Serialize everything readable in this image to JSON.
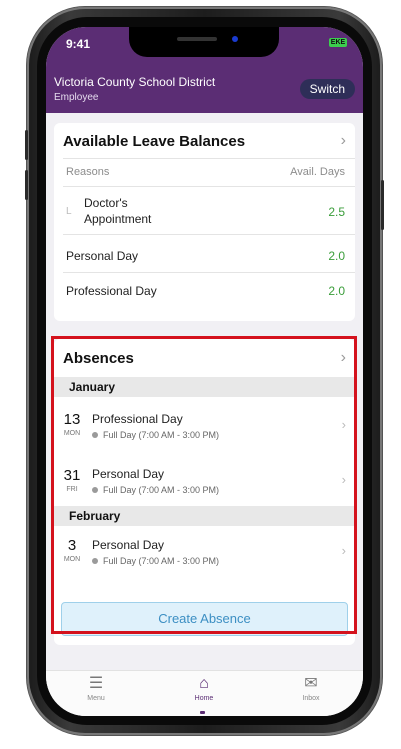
{
  "status": {
    "time": "9:41",
    "battery": "EKE"
  },
  "header": {
    "org": "Victoria County School District",
    "role": "Employee",
    "switch_label": "Switch"
  },
  "leave": {
    "title": "Available Leave Balances",
    "col_reasons": "Reasons",
    "col_days": "Avail. Days",
    "rows": [
      {
        "reason_line1": "Doctor's",
        "reason_line2": "Appointment",
        "days": "2.5"
      },
      {
        "reason": "Personal Day",
        "days": "2.0"
      },
      {
        "reason": "Professional Day",
        "days": "2.0"
      }
    ]
  },
  "absences": {
    "title": "Absences",
    "months": [
      "January",
      "February"
    ],
    "items": [
      {
        "day": "13",
        "dow": "MON",
        "title": "Professional Day",
        "detail": "Full Day (7:00 AM - 3:00 PM)"
      },
      {
        "day": "31",
        "dow": "FRI",
        "title": "Personal Day",
        "detail": "Full Day (7:00 AM - 3:00 PM)"
      },
      {
        "day": "3",
        "dow": "MON",
        "title": "Personal Day",
        "detail": "Full Day (7:00 AM - 3:00 PM)"
      }
    ],
    "create_label": "Create Absence"
  },
  "tabs": [
    {
      "label": "Menu",
      "icon": "menu-icon"
    },
    {
      "label": "Home",
      "icon": "home-icon"
    },
    {
      "label": "Inbox",
      "icon": "inbox-icon"
    }
  ],
  "colors": {
    "brand": "#5b2d74",
    "accent_green": "#3a9d3a",
    "highlight": "#d4121d",
    "button_blue": "#3c8fc3"
  }
}
